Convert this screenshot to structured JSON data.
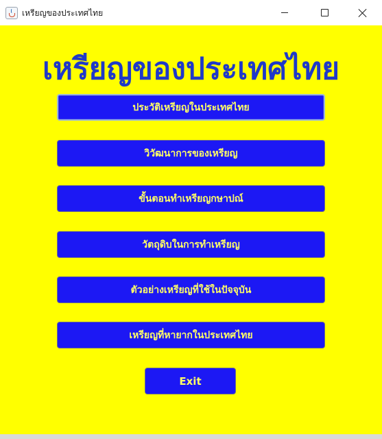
{
  "window": {
    "title": "เหรียญของประเทศไทย",
    "controls": [
      "minimize",
      "maximize",
      "close"
    ]
  },
  "main": {
    "heading": "เหรียญของประเทศไทย",
    "menu": [
      {
        "label": "ประวัติเหรียญในประเทศไทย",
        "focused": true
      },
      {
        "label": "วิวัฒนาการของเหรียญ"
      },
      {
        "label": "ขั้นตอนทำเหรียญกษาปณ์"
      },
      {
        "label": "วัตถุดิบในการทำเหรียญ"
      },
      {
        "label": "ตัวอย่างเหรียญที่ใช้ในปัจจุบัน"
      },
      {
        "label": "เหรียญที่หายากในประเทศไทย"
      }
    ],
    "exit_label": "Exit"
  },
  "colors": {
    "background": "#ffff00",
    "heading": "#1f39c9",
    "button_bg": "#1c18f4",
    "button_text": "#ffff66"
  },
  "icons": {
    "app": "java-cup-icon",
    "minimize": "minimize-icon",
    "maximize": "maximize-icon",
    "close": "close-icon"
  }
}
